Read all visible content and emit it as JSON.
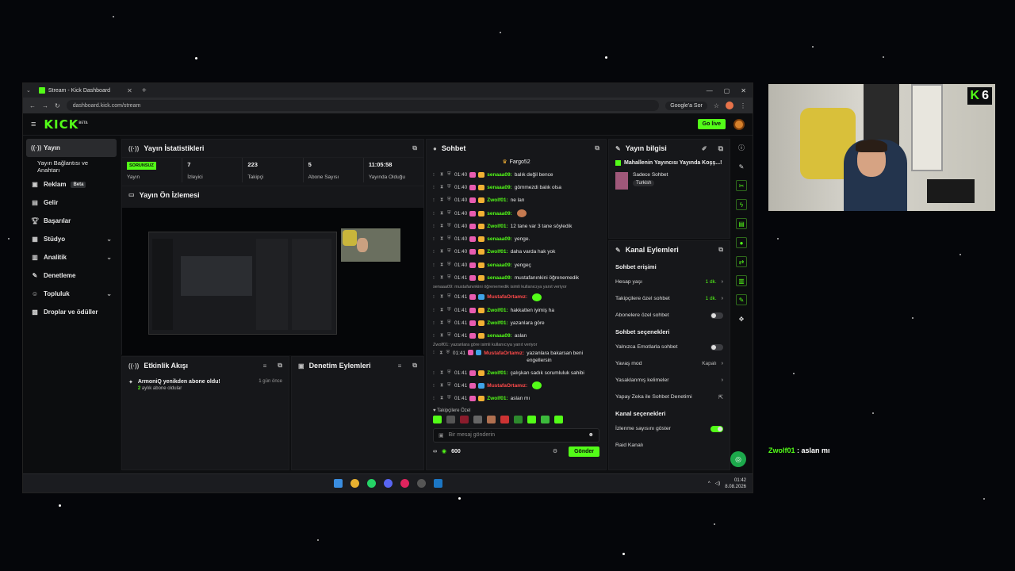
{
  "browser": {
    "tab_title": "Stream - Kick Dashboard",
    "url": "dashboard.kick.com/stream",
    "ask_google": "Google'a Sor"
  },
  "header": {
    "logo": "KICK",
    "logo_beta": "BETA",
    "go_live": "Go live"
  },
  "sidebar": {
    "items": [
      {
        "label": "Yayın",
        "icon": "broadcast-icon"
      },
      {
        "label": "Yayın Bağlantısı ve Anahtarı",
        "icon": ""
      },
      {
        "label": "Reklam",
        "icon": "ad-icon",
        "badge": "Beta"
      },
      {
        "label": "Gelir",
        "icon": "wallet-icon"
      },
      {
        "label": "Başarılar",
        "icon": "trophy-icon"
      },
      {
        "label": "Stüdyo",
        "icon": "studio-icon"
      },
      {
        "label": "Analitik",
        "icon": "chart-icon"
      },
      {
        "label": "Denetleme",
        "icon": "wrench-icon"
      },
      {
        "label": "Topluluk",
        "icon": "community-icon"
      },
      {
        "label": "Droplar ve ödüller",
        "icon": "gift-icon"
      }
    ]
  },
  "stats_panel": {
    "title": "Yayın İstatistikleri",
    "status": "SORUNSUZ",
    "status_label": "Yayın",
    "viewers": "7",
    "viewers_label": "İzleyici",
    "followers": "223",
    "followers_label": "Takipçi",
    "subs": "5",
    "subs_label": "Abone Sayısı",
    "uptime": "11:05:58",
    "uptime_label": "Yayında Olduğu"
  },
  "preview_panel": {
    "title": "Yayın Ön İzlemesi"
  },
  "activity_panel": {
    "title": "Etkinlik Akışı",
    "event_text": "ArmoniQ yenikden abone oldu!",
    "event_duration_num": "2",
    "event_duration_rest": "aylık abone oldular",
    "event_time": "1 gün önce"
  },
  "moderation_panel": {
    "title": "Denetim Eylemleri"
  },
  "chat": {
    "title": "Sohbet",
    "pinned_user": "Fargo52",
    "messages": [
      {
        "time": "01:40",
        "user": "senaaa09:",
        "text": "balık değil bence",
        "color": "green"
      },
      {
        "time": "01:40",
        "user": "senaaa09:",
        "text": "gömmezdi balık olsa",
        "color": "green"
      },
      {
        "time": "01:40",
        "user": "Zwolf01:",
        "text": "ne lan",
        "color": "green"
      },
      {
        "time": "01:40",
        "user": "senaaa09:",
        "text": "",
        "color": "green"
      },
      {
        "time": "01:40",
        "user": "Zwolf01:",
        "text": "12 tane var 3 tane söyledik",
        "color": "green"
      },
      {
        "time": "01:40",
        "user": "senaaa09:",
        "text": "yenge.",
        "color": "green"
      },
      {
        "time": "01:40",
        "user": "Zwolf01:",
        "text": "daha varda hak yok",
        "color": "green"
      },
      {
        "time": "01:40",
        "user": "senaaa09:",
        "text": "yengeç",
        "color": "green"
      },
      {
        "time": "01:41",
        "user": "senaaa09:",
        "text": "mustafanınkini öğrenemedik",
        "color": "green"
      },
      {
        "time": "01:41",
        "user": "MustafaOrtamız:",
        "text": "",
        "color": "red"
      },
      {
        "time": "01:41",
        "user": "Zwolf01:",
        "text": "hakkatten iyimiş ha",
        "color": "green"
      },
      {
        "time": "01:41",
        "user": "Zwolf01:",
        "text": "yazanlara göre",
        "color": "green"
      },
      {
        "time": "01:41",
        "user": "senaaa09:",
        "text": "aslan",
        "color": "green"
      },
      {
        "time": "01:41",
        "user": "MustafaOrtamız:",
        "text": "yazanlara bakarsan beni engellersin",
        "color": "red"
      },
      {
        "time": "01:41",
        "user": "Zwolf01:",
        "text": "çalışkan sadık sorumluluk sahibi",
        "color": "green"
      },
      {
        "time": "01:41",
        "user": "MustafaOrtamız:",
        "text": "",
        "color": "red"
      },
      {
        "time": "01:41",
        "user": "Zwolf01:",
        "text": "aslan mı",
        "color": "green"
      }
    ],
    "reply1": "senaaa09: mustafanınkini öğrenemedik isimli kullanıcıya yanıt veriyor",
    "reply2": "Zwolf01: yazanlara göre isimli kullanıcıya yanıt veriyor",
    "followers_only": "Takipçilere Özel",
    "input_placeholder": "Bir mesaj gönderin",
    "points": "600",
    "send_label": "Gönder"
  },
  "stream_info": {
    "title": "Yayın bilgisi",
    "stream_title": "Mahallenin Yayıncısı Yayında Koşş...!",
    "category": "Sadece Sohbet",
    "tag": "Turkish"
  },
  "channel_actions": {
    "title": "Kanal Eylemleri",
    "chat_access": "Sohbet erişimi",
    "account_age": "Hesap yaşı",
    "account_age_val": "1 dk.",
    "followers_only": "Takipçilere özel sohbet",
    "followers_only_val": "1 dk.",
    "subs_only": "Abonelere özel sohbet",
    "chat_options": "Sohbet seçenekleri",
    "emotes_only": "Yalnızca Emotlarla sohbet",
    "slow_mode": "Yavaş mod",
    "slow_mode_val": "Kapalı",
    "banned_words": "Yasaklanmış kelimeler",
    "ai_mod": "Yapay Zeka ile Sohbet Denetimi",
    "channel_options": "Kanal seçenekleri",
    "show_viewers": "İzlenme sayısını göster",
    "raid": "Raid Kanalı"
  },
  "taskbar": {
    "time": "01:42",
    "date": "8.08.2026"
  },
  "webcam": {
    "badge_number": "6"
  },
  "overlay_chat": {
    "user": "Zwolf01",
    "text": " : aslan mı"
  },
  "colors": {
    "accent": "#53fc18",
    "bg": "#0e0f11",
    "panel": "#16171a"
  }
}
